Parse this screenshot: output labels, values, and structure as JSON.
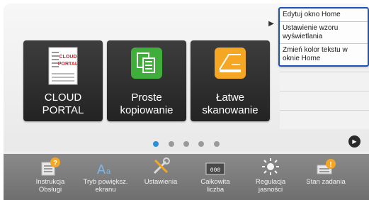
{
  "tiles": [
    {
      "label_lines": [
        "CLOUD PORTAL"
      ],
      "icon": "cloud-portal-icon",
      "icon_text": [
        "CLOUD",
        "PORTAL"
      ]
    },
    {
      "label_lines": [
        "Proste",
        "kopiowanie"
      ],
      "icon": "copy-icon"
    },
    {
      "label_lines": [
        "Łatwe",
        "skanowanie"
      ],
      "icon": "scan-icon"
    }
  ],
  "menu": {
    "toggle_icon": "play-left-icon",
    "items": [
      "Edytuj okno Home",
      "Ustawienie wzoru wyświetlania",
      "Zmień kolor tekstu w oknie Home"
    ]
  },
  "pagination": {
    "pages": 5,
    "current": 1
  },
  "taskbar": [
    {
      "label": "Instrukcja Obsługi",
      "icon": "manual-help-icon"
    },
    {
      "label": "Tryb powiększ. ekranu",
      "icon": "enlarge-text-icon"
    },
    {
      "label": "Ustawienia",
      "icon": "tools-icon"
    },
    {
      "label": "Całkowita liczba",
      "icon": "counter-icon",
      "icon_text": "000"
    },
    {
      "label": "Regulacja jasności",
      "icon": "brightness-icon"
    },
    {
      "label": "Stan zadania",
      "icon": "job-status-icon"
    }
  ],
  "colors": {
    "accent": "#1a52b5",
    "dot_active": "#2a8fd6",
    "dot_inactive": "#9a9a9a",
    "tile_bg": "#2d2d2d",
    "taskbar_bg": "#7c7c7c",
    "copy_green": "#3fae3a",
    "scan_orange": "#f5a623"
  }
}
